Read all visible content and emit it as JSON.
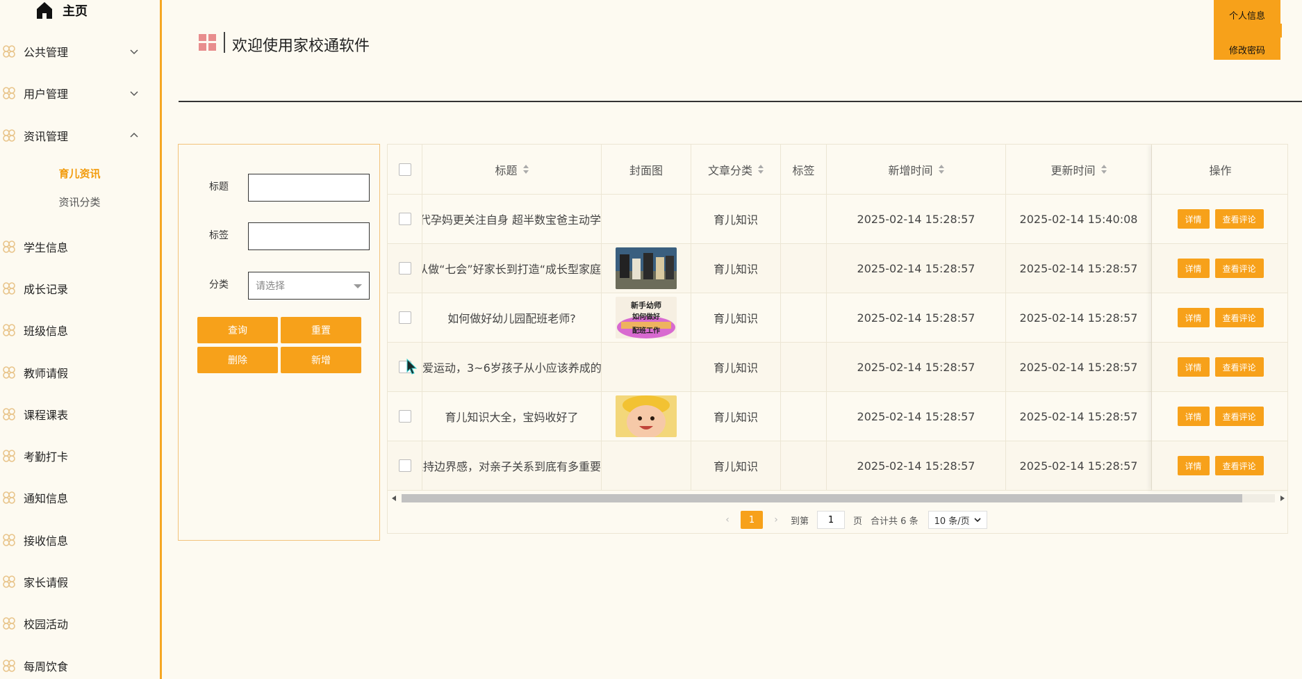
{
  "sidebar": {
    "home_label": "主页",
    "items": [
      {
        "label": "公共管理",
        "chevron": "down"
      },
      {
        "label": "用户管理",
        "chevron": "down"
      },
      {
        "label": "资讯管理",
        "chevron": "up"
      },
      {
        "label": "学生信息"
      },
      {
        "label": "成长记录"
      },
      {
        "label": "班级信息"
      },
      {
        "label": "教师请假"
      },
      {
        "label": "课程课表"
      },
      {
        "label": "考勤打卡"
      },
      {
        "label": "通知信息"
      },
      {
        "label": "接收信息"
      },
      {
        "label": "家长请假"
      },
      {
        "label": "校园活动"
      },
      {
        "label": "每周饮食"
      }
    ],
    "sub_items": [
      {
        "label": "育儿资讯",
        "active": true
      },
      {
        "label": "资讯分类",
        "active": false
      }
    ]
  },
  "header": {
    "title": "欢迎使用家校通软件",
    "user_menu": [
      "个人信息",
      "修改密码"
    ]
  },
  "search": {
    "title_label": "标题",
    "title_value": "",
    "tag_label": "标签",
    "tag_value": "",
    "category_label": "分类",
    "category_placeholder": "请选择",
    "query_button": "查询",
    "reset_button": "重置",
    "delete_button": "删除",
    "add_button": "新增"
  },
  "table": {
    "columns": [
      "标题",
      "封面图",
      "文章分类",
      "标签",
      "新增时间",
      "更新时间",
      "操作"
    ],
    "rows": [
      {
        "title": "代孕妈更关注自身 超半数宝爸主动学",
        "cover": "",
        "category": "育儿知识",
        "tag": "",
        "created": "2025-02-14 15:28:57",
        "updated": "2025-02-14 15:40:08"
      },
      {
        "title": "从做“七会”好家长到打造“成长型家庭”",
        "cover": "group-photo",
        "category": "育儿知识",
        "tag": "",
        "created": "2025-02-14 15:28:57",
        "updated": "2025-02-14 15:28:57"
      },
      {
        "title": "如何做好幼儿园配班老师?",
        "cover": "teacher-poster",
        "category": "育儿知识",
        "tag": "",
        "created": "2025-02-14 15:28:57",
        "updated": "2025-02-14 15:28:57"
      },
      {
        "title": "爱运动，3~6岁孩子从小应该养成的",
        "cover": "",
        "category": "育儿知识",
        "tag": "",
        "created": "2025-02-14 15:28:57",
        "updated": "2025-02-14 15:28:57"
      },
      {
        "title": "育儿知识大全，宝妈收好了",
        "cover": "baby-photo",
        "category": "育儿知识",
        "tag": "",
        "created": "2025-02-14 15:28:57",
        "updated": "2025-02-14 15:28:57"
      },
      {
        "title": "保持边界感，对亲子关系到底有多重要",
        "cover": "",
        "category": "育儿知识",
        "tag": "",
        "created": "2025-02-14 15:28:57",
        "updated": "2025-02-14 15:28:57"
      }
    ],
    "detail_button": "详情",
    "comment_button": "查看评论",
    "cover_poster_text": "新手幼师 如何做好 配班工作"
  },
  "pagination": {
    "current_page": "1",
    "goto_label": "到第",
    "goto_value": "1",
    "page_suffix": "页",
    "total_text": "合计共 6 条",
    "page_size": "10 条/页"
  },
  "colors": {
    "accent": "#f7a11a",
    "background": "#fdfaf1",
    "active_sub": "#f29b0c"
  }
}
